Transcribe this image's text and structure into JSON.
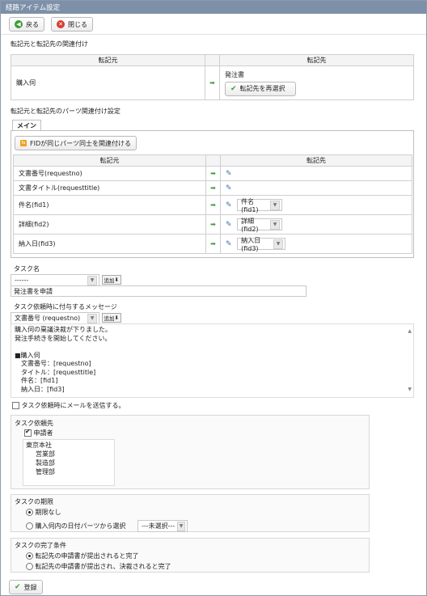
{
  "window": {
    "title": "経路アイテム設定"
  },
  "toolbar": {
    "back_label": "戻る",
    "close_label": "閉じる"
  },
  "mapping": {
    "section_title": "転記元と転記先の関連付け",
    "src_header": "転記元",
    "dst_header": "転記先",
    "src_value": "購入伺",
    "dst_value": "発注書",
    "reselect_label": "転記先を再選択"
  },
  "parts": {
    "section_title": "転記元と転記先のパーツ関連付け設定",
    "tab_label": "メイン",
    "fid_button_label": "FIDが同じパーツ同士を関連付ける",
    "src_header": "転記元",
    "dst_header": "転記先",
    "rows": [
      {
        "src": "文書番号(requestno)",
        "dst": ""
      },
      {
        "src": "文書タイトル(requesttitle)",
        "dst": ""
      },
      {
        "src": "件名(fid1)",
        "dst": "件名 (fid1)"
      },
      {
        "src": "詳細(fid2)",
        "dst": "詳細 (fid2)"
      },
      {
        "src": "納入日(fid3)",
        "dst": "納入日 (fid3)"
      }
    ]
  },
  "task_name": {
    "label": "タスク名",
    "select_value": "------",
    "add_label": "追加",
    "input_value": "発注書を申請"
  },
  "message": {
    "label": "タスク依頼時に付与するメッセージ",
    "select_value": "文書番号 (requestno)",
    "add_label": "追加",
    "lines": [
      "購入伺の稟議決裁が下りました。",
      "発注手続きを開始してください。",
      "",
      "■購入伺",
      "　文書番号：[requestno]",
      "　タイトル：[requesttitle]",
      "　件名：[fid1]",
      "　納入日：[fid3]"
    ]
  },
  "send_mail_label": "タスク依頼時にメールを送信する。",
  "assignee": {
    "label": "タスク依頼先",
    "applicant_label": "申請者",
    "org_root": "東京本社",
    "org_children": [
      "営業部",
      "製造部",
      "管理部"
    ]
  },
  "deadline": {
    "label": "タスクの期限",
    "option_none": "期限なし",
    "option_date": "購入伺内の日付パーツから選択",
    "date_select_value": "---未選択---"
  },
  "completion": {
    "label": "タスクの完了条件",
    "option_submitted": "転記先の申請書が提出されると完了",
    "option_approved": "転記先の申請書が提出され、決裁されると完了"
  },
  "register_label": "登録",
  "colors": {
    "titlebar": "#7d90a8",
    "accent_green": "#3f9c35",
    "accent_red": "#d33f2f",
    "edit_blue": "#3b6fb8"
  }
}
